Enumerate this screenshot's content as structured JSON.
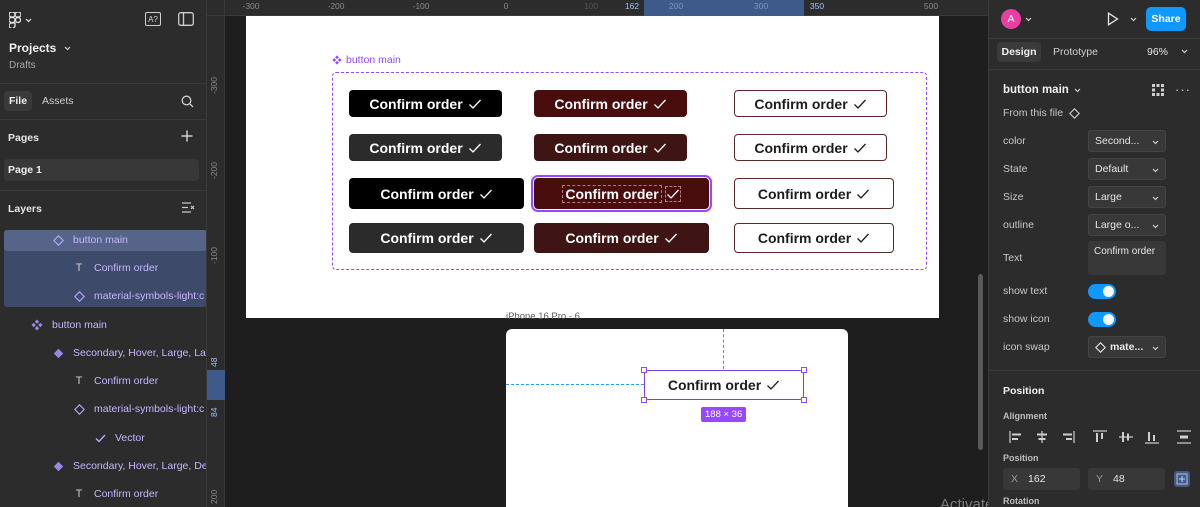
{
  "app": {
    "projects_title": "Projects",
    "drafts_label": "Drafts"
  },
  "left_panel": {
    "tabs": {
      "file": "File",
      "assets": "Assets"
    },
    "pages_heading": "Pages",
    "page_1": "Page 1",
    "layers_heading": "Layers",
    "layers": [
      {
        "label": "button main",
        "kind": "component-instance"
      },
      {
        "label": "Confirm order",
        "kind": "text"
      },
      {
        "label": "material-symbols-light:c",
        "kind": "instance"
      },
      {
        "label": "button main",
        "kind": "component-set"
      },
      {
        "label": "Secondary, Hover, Large, Lar",
        "kind": "component"
      },
      {
        "label": "Confirm order",
        "kind": "text"
      },
      {
        "label": "material-symbols-light:c",
        "kind": "instance"
      },
      {
        "label": "Vector",
        "kind": "vector"
      },
      {
        "label": "Secondary, Hover, Large, Def",
        "kind": "component"
      },
      {
        "label": "Confirm order",
        "kind": "text"
      }
    ]
  },
  "rulers": {
    "top": [
      "-300",
      "-200",
      "-100",
      "0",
      "100",
      "162",
      "200",
      "300",
      "350",
      "500"
    ],
    "left": [
      "-300",
      "-200",
      "-100",
      "48",
      "84",
      "200"
    ]
  },
  "canvas": {
    "component_set_label": "button main",
    "button_text": "Confirm order",
    "frame_label": "iPhone 16 Pro - 6",
    "selection_size": "188 × 36",
    "watermark": "Activate Windows"
  },
  "right_panel": {
    "avatar_initial": "A",
    "share_label": "Share",
    "tabs": {
      "design": "Design",
      "prototype": "Prototype"
    },
    "zoom": "96%",
    "component_name": "button main",
    "from_file": "From this file",
    "properties": {
      "color": {
        "label": "color",
        "value": "Second..."
      },
      "state": {
        "label": "State",
        "value": "Default"
      },
      "size": {
        "label": "Size",
        "value": "Large"
      },
      "outline": {
        "label": "outline",
        "value": "Large o..."
      },
      "text": {
        "label": "Text",
        "value": "Confirm order"
      },
      "show_text": {
        "label": "show text",
        "value": true
      },
      "show_icon": {
        "label": "show icon",
        "value": true
      },
      "icon_swap": {
        "label": "icon swap",
        "value": "mate..."
      }
    },
    "position_heading": "Position",
    "alignment_label": "Alignment",
    "position_label": "Position",
    "x_label": "X",
    "x_value": "162",
    "y_label": "Y",
    "y_value": "48",
    "rotation_label": "Rotation"
  },
  "colors": {
    "accent": "#0d99ff",
    "component_purple": "#9747ff",
    "maroon": "#4a0d0d",
    "share_blue": "#0d99ff"
  }
}
